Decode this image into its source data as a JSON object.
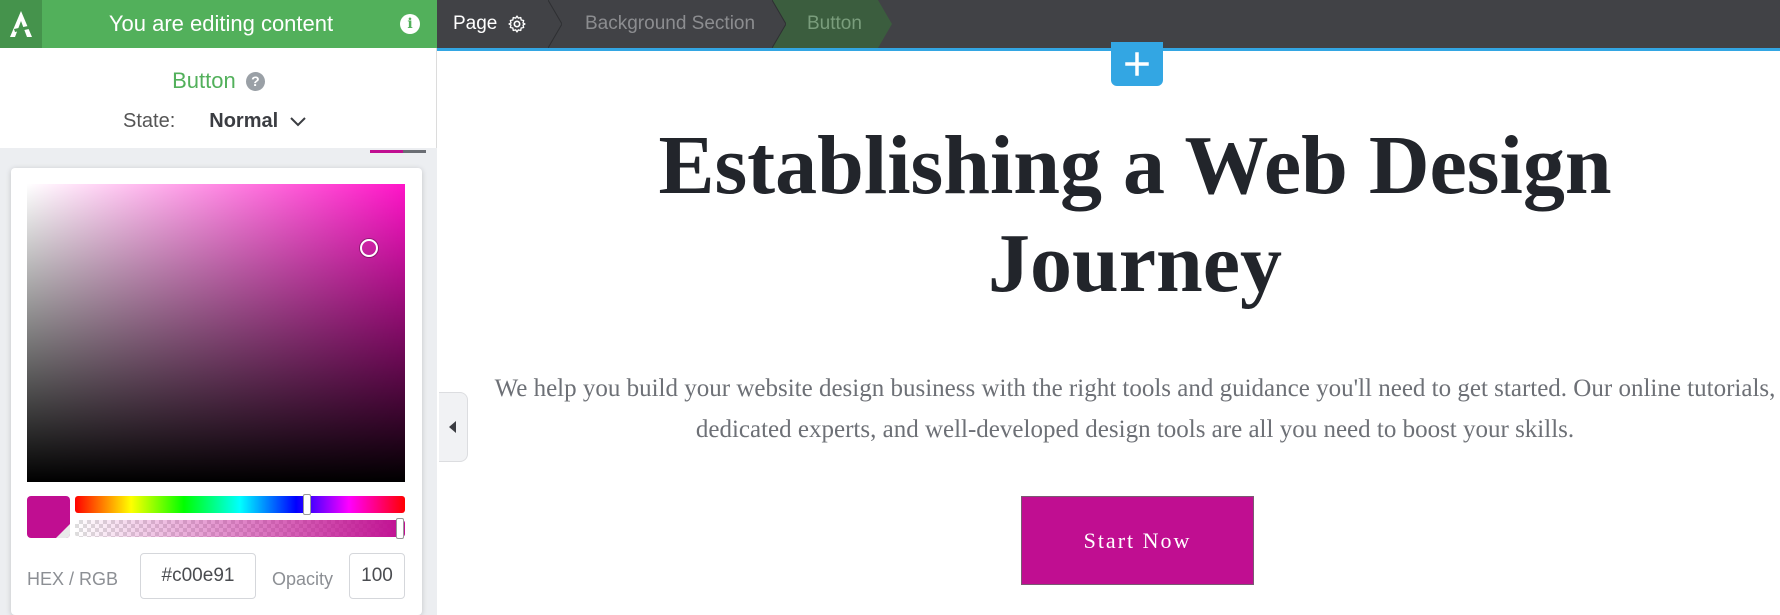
{
  "header": {
    "editing_label": "You are editing content",
    "info_icon": "i",
    "breadcrumb": [
      "Page",
      "Background Section",
      "Button"
    ]
  },
  "panel": {
    "title": "Button",
    "help_icon": "?",
    "state_label": "State:",
    "state_value": "Normal"
  },
  "color_picker": {
    "hex_label": "HEX / RGB",
    "hex_value": "#c00e91",
    "opacity_label": "Opacity",
    "opacity_value": "100",
    "selected_color": "#c00e91"
  },
  "canvas": {
    "add_icon": "plus-icon",
    "headline": "Establishing a Web Design Journey",
    "subtext": "We help you build your website design business with the right tools and guidance you'll need to get started. Our online tutorials, dedicated experts, and well-developed design tools are all you need to boost your skills.",
    "cta_label": "Start Now"
  },
  "colors": {
    "topbar": "#414246",
    "editing_green": "#52b05b",
    "accent_blue": "#33a6e3",
    "button_magenta": "#c00e91"
  }
}
